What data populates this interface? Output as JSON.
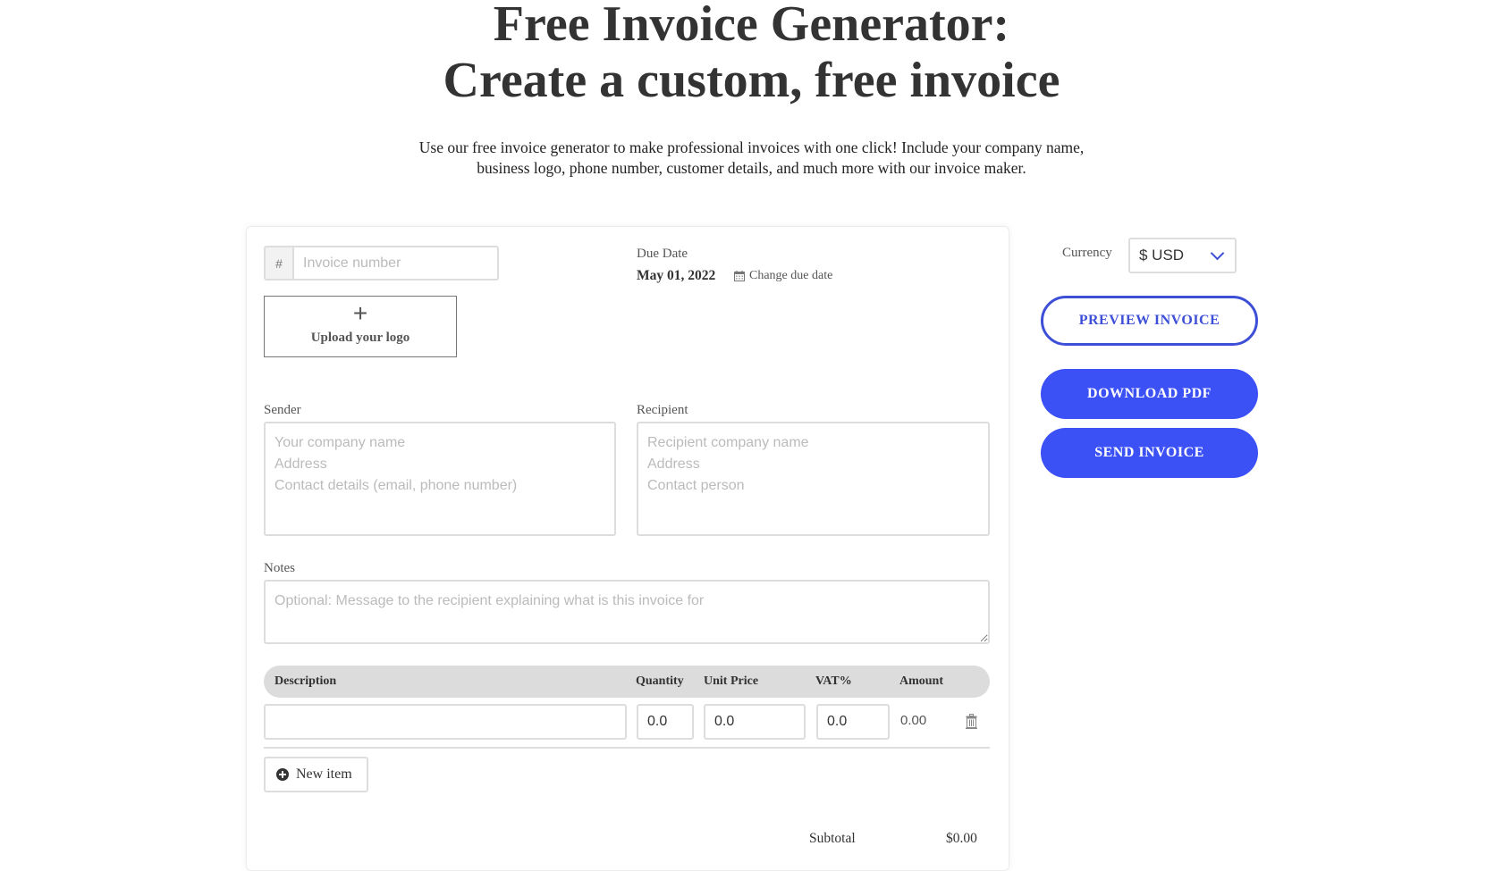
{
  "header": {
    "title_line1": "Free Invoice Generator:",
    "title_line2": "Create a custom, free invoice",
    "subtitle_line1": "Use our free invoice generator to make professional invoices with one click! Include your company name,",
    "subtitle_line2": "business logo, phone number, customer details, and much more with our invoice maker."
  },
  "invoice": {
    "number_prefix": "#",
    "number_placeholder": "Invoice number",
    "number_value": "",
    "upload_logo_label": "Upload your logo",
    "due_date_label": "Due Date",
    "due_date_value": "May 01, 2022",
    "change_due_date_label": "Change due date"
  },
  "sender": {
    "label": "Sender",
    "placeholder": "Your company name\nAddress\nContact details (email, phone number)"
  },
  "recipient": {
    "label": "Recipient",
    "placeholder": "Recipient company name\nAddress\nContact person"
  },
  "notes": {
    "label": "Notes",
    "placeholder": "Optional: Message to the recipient explaining what is this invoice for"
  },
  "items_table": {
    "columns": [
      "Description",
      "Quantity",
      "Unit Price",
      "VAT%",
      "Amount"
    ],
    "rows": [
      {
        "description": "",
        "quantity": "0.0",
        "unit_price": "0.0",
        "vat": "0.0",
        "amount": "0.00"
      }
    ],
    "new_item_label": "New item"
  },
  "totals": {
    "subtotal_label": "Subtotal",
    "subtotal_value": "$0.00"
  },
  "sidebar": {
    "currency_label": "Currency",
    "currency_value": "$ USD",
    "preview_label": "PREVIEW INVOICE",
    "download_label": "DOWNLOAD PDF",
    "send_label": "SEND INVOICE"
  },
  "colors": {
    "accent": "#3b50f5",
    "accent_outline": "#3d4fd6",
    "table_header_bg": "#dcdcdc"
  }
}
